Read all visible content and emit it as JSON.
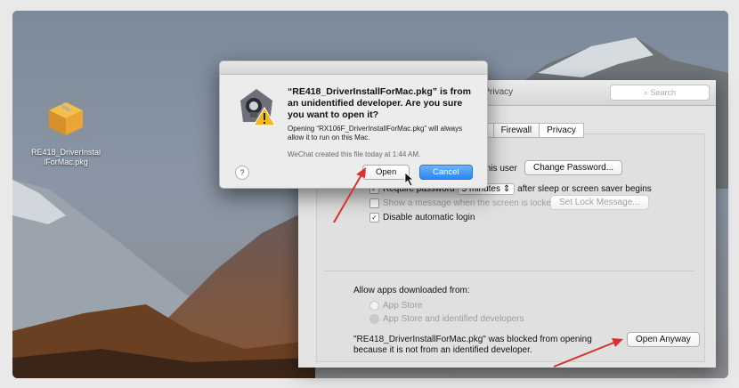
{
  "desktop": {
    "file_icon": "package-icon",
    "file_label": "RE418_DriverInstallForMac.pkg"
  },
  "prefs_window": {
    "title": "Security & Privacy",
    "search_placeholder": "Search",
    "tabs": [
      {
        "label": "eVault"
      },
      {
        "label": "Firewall"
      },
      {
        "label": "Privacy"
      }
    ],
    "password_row": {
      "text": "this user",
      "button": "Change Password..."
    },
    "require_password": {
      "label": "Require password",
      "select_value": "5 minutes",
      "suffix": "after sleep or screen saver begins"
    },
    "show_message": {
      "label": "Show a message when the screen is locked",
      "button": "Set Lock Message..."
    },
    "disable_login": {
      "label": "Disable automatic login",
      "checked": true
    },
    "allow_apps": {
      "heading": "Allow apps downloaded from:",
      "options": [
        {
          "label": "App Store"
        },
        {
          "label": "App Store and identified developers"
        }
      ]
    },
    "blocked_message": "\"RE418_DriverInstallForMac.pkg\" was blocked from opening because it is not from an identified developer.",
    "open_anyway_button": "Open Anyway"
  },
  "dialog": {
    "icon": "gatekeeper-warning-icon",
    "heading": "“RE418_DriverInstallForMac.pkg” is from an unidentified developer. Are you sure you want to open it?",
    "body": "Opening “RX106F_DriverInstallForMac.pkg” will always allow it to run on this Mac.",
    "note": "WeChat created this file today at 1:44 AM.",
    "help_label": "?",
    "open_button": "Open",
    "cancel_button": "Cancel"
  },
  "colors": {
    "arrow": "#d8322c",
    "accent": "#2a86f3"
  }
}
